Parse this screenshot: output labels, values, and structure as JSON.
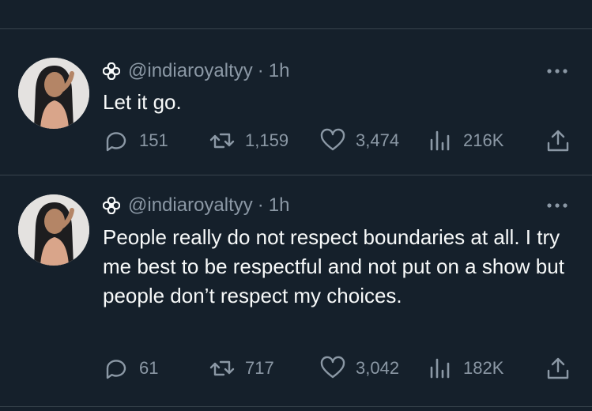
{
  "tweets": [
    {
      "handle": "@indiaroyaltyy",
      "separator": "·",
      "time": "1h",
      "text": "Let it go.",
      "replies": "151",
      "retweets": "1,159",
      "likes": "3,474",
      "views": "216K"
    },
    {
      "handle": "@indiaroyaltyy",
      "separator": "·",
      "time": "1h",
      "text": "People really do not respect boundaries at all. I try me best to be respectful and not put on a show but people don’t respect my choices.",
      "replies": "61",
      "retweets": "717",
      "likes": "3,042",
      "views": "182K"
    }
  ],
  "icons": {
    "badge": "flower-icon",
    "more": "more-icon",
    "reply": "reply-icon",
    "retweet": "retweet-icon",
    "like": "heart-icon",
    "views": "views-icon",
    "share": "share-icon"
  },
  "colors": {
    "background": "#15202b",
    "text": "#f7f9f9",
    "secondary": "#8b98a5",
    "divider": "#38444d"
  }
}
